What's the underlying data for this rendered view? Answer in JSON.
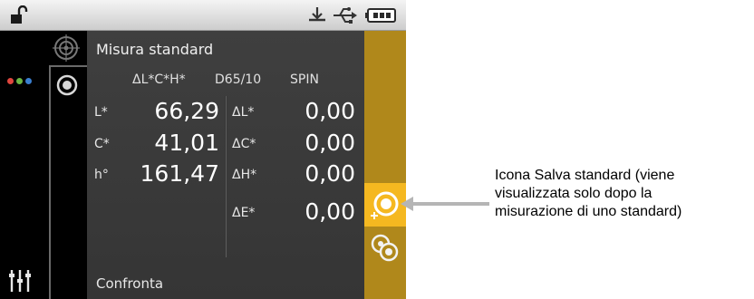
{
  "status_bar": {
    "lock_icon": "unlock-icon",
    "usb_icon": "usb-icon",
    "download_icon": "download-icon",
    "battery_icon": "battery-icon"
  },
  "left_rail": {
    "dots": [
      "#e0463e",
      "#6cb644",
      "#3a7fd0"
    ],
    "settings_icon": "sliders-icon"
  },
  "screen": {
    "title": "Misura standard",
    "header": {
      "formula": "ΔL*C*H*",
      "illuminant": "D65/10",
      "mode": "SPIN"
    },
    "rows": [
      {
        "label": "L*",
        "value": "66,29",
        "delta_label": "ΔL*",
        "delta_value": "0,00"
      },
      {
        "label": "C*",
        "value": "41,01",
        "delta_label": "ΔC*",
        "delta_value": "0,00"
      },
      {
        "label": "h°",
        "value": "161,47",
        "delta_label": "ΔH*",
        "delta_value": "0,00"
      },
      {
        "label": "",
        "value": "",
        "delta_label": "ΔE*",
        "delta_value": "0,00"
      }
    ],
    "footer": "Confronta"
  },
  "right_rail": {
    "highlight_color": "#f5b820",
    "rail_color": "#b0881b"
  },
  "callout": {
    "lines": [
      "Icona Salva standard (viene",
      "visualizzata solo dopo la",
      "misurazione di uno standard)"
    ]
  }
}
